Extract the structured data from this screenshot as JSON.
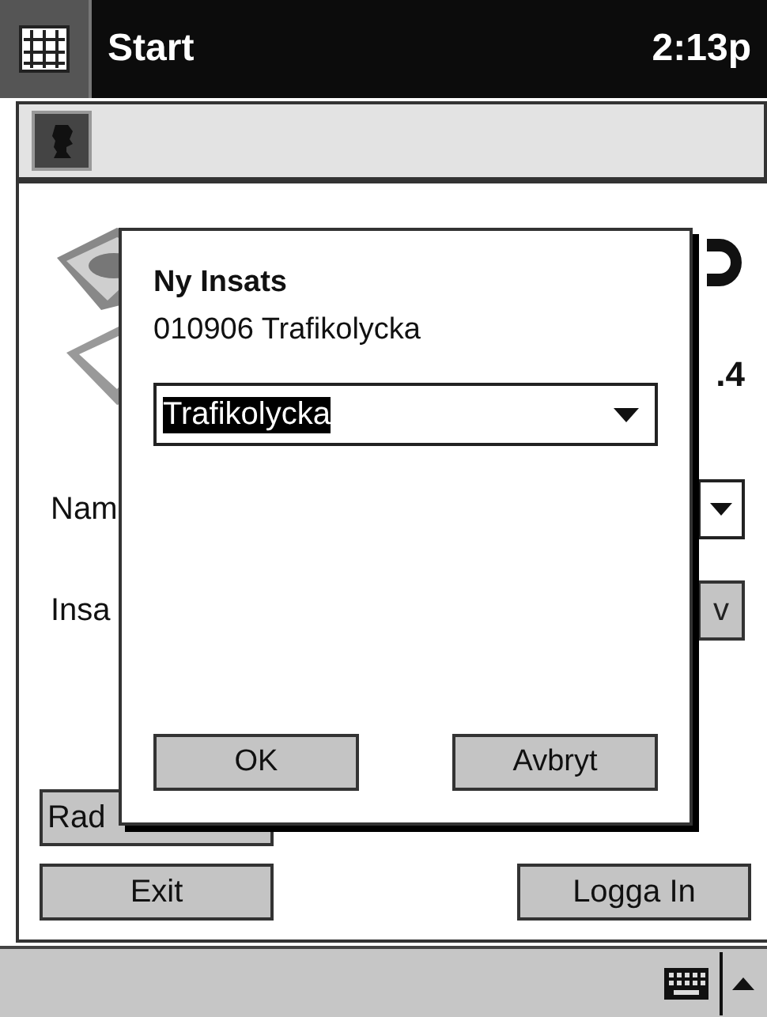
{
  "title_bar": {
    "start_label": "Start",
    "time": "2:13p"
  },
  "main": {
    "version_fragment": ".4",
    "fields": [
      {
        "label": "Nam",
        "kind": "dropdown"
      },
      {
        "label": "Insa",
        "kind": "button",
        "button_text": "v"
      }
    ],
    "buttons": [
      {
        "label": "Rad"
      },
      {
        "label": "Exit"
      },
      {
        "label": "Logga In"
      }
    ]
  },
  "dialog": {
    "title": "Ny Insats",
    "subtitle": "010906 Trafikolycka",
    "combo": {
      "value": "Trafikolycka",
      "text_selected": true
    },
    "buttons": [
      "OK",
      "Avbryt"
    ]
  }
}
